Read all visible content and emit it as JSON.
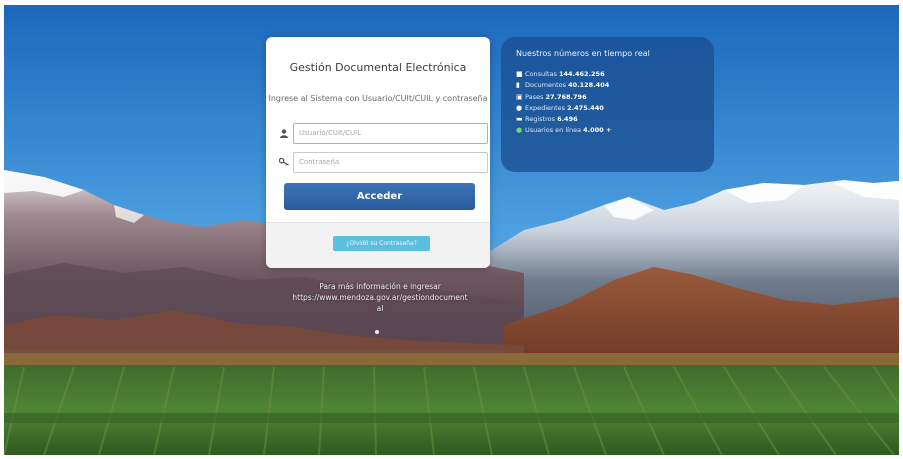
{
  "login": {
    "title": "Gestión Documental Electrónica",
    "subtitle": "Ingrese al Sistema con Usuario/CUIt/CUIL y contraseña",
    "username_placeholder": "Usuario/CUIt/CUIL",
    "password_placeholder": "Contraseña",
    "submit_label": "Acceder",
    "help_label": "¿Olvidó su Contraseña?"
  },
  "stats": {
    "title": "Nuestros números en tiempo real",
    "items": [
      {
        "icon": "comment-icon",
        "label": "Consultas",
        "value": "144.462.256"
      },
      {
        "icon": "document-icon",
        "label": "Documentos",
        "value": "40.128.404"
      },
      {
        "icon": "file-icon",
        "label": "Pases",
        "value": "27.768.796"
      },
      {
        "icon": "folder-icon",
        "label": "Expedientes",
        "value": "2.475.440"
      },
      {
        "icon": "folder-open-icon",
        "label": "Registros",
        "value": "6.496"
      },
      {
        "icon": "user-icon",
        "label": "Usuarios en línea",
        "value": "4.000 +"
      }
    ]
  },
  "footer": {
    "info_line1": "Para más información e ingresar",
    "info_line2": "https://www.mendoza.gov.ar/gestiondocument",
    "info_line3": "al"
  },
  "colors": {
    "primary_button": "#2e65a8",
    "help_button": "#5bc0de",
    "stats_panel": "#1f4e8a",
    "online_indicator": "#6fd36f"
  }
}
